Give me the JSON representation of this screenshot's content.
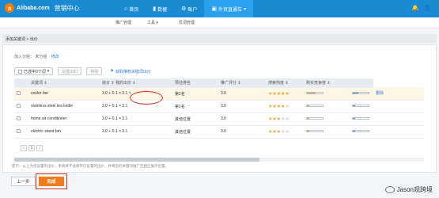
{
  "header": {
    "logo_mark": "a",
    "logo_text": "Alibaba.com",
    "logo_sub": "营销中心",
    "nav": [
      {
        "icon": "⌂",
        "label": "首页"
      },
      {
        "icon": "▮",
        "label": "数据"
      },
      {
        "icon": "⚙",
        "label": "账户"
      },
      {
        "icon": "▣",
        "label": "外贸直通车",
        "suffix": "▾"
      }
    ],
    "right_icons": [
      "🔔",
      "👤"
    ]
  },
  "subnav": {
    "items": [
      "推广管理",
      "工具 ▾",
      "优词管理"
    ]
  },
  "breadcrumb": "添加关键词 > 出价",
  "group": {
    "label": "加入分组：",
    "value": "未分组",
    "edit": "修改"
  },
  "toolbar": {
    "select": "已选中0个词",
    "buttons": [
      "设置出价",
      "移除"
    ],
    "link": "获取推荐关键词出价"
  },
  "table": {
    "headers": [
      "",
      "关键词 ⇕",
      "底价 ⇕ 我的出价 ⇕",
      "预估排名",
      "推广评分 ⇕",
      "搜索热度 ⇕",
      "购买竞争度 ⇕",
      ""
    ],
    "rows": [
      {
        "keyword": "cooler fan",
        "bid": "3.0  +  0.1  =  3.1",
        "rank": "第1名",
        "score": "3.0",
        "stars": 5,
        "heat": 0.55,
        "comp": 0.35,
        "action": "删除"
      },
      {
        "keyword": "stainless steel tea kettle",
        "bid": "3.0  +  0.1  =  3.1",
        "rank": "第1名",
        "score": "3.0",
        "stars": 4,
        "heat": 0.15,
        "comp": 0.15,
        "action": ""
      },
      {
        "keyword": "home air conditioner",
        "bid": "3.0  +  0.1  =  3.1",
        "rank": "其他位置",
        "score": "3.0",
        "stars": 3,
        "heat": 0.15,
        "comp": 0.15,
        "action": ""
      },
      {
        "keyword": "electric stand fan",
        "bid": "3.0  +  0.1  =  3.1",
        "rank": "其他位置",
        "score": "3.0",
        "stars": 3,
        "heat": 0.15,
        "comp": 0.15,
        "action": ""
      }
    ]
  },
  "pager": {
    "prev": "‹",
    "current": "1",
    "next": "›"
  },
  "note": "提示：以上为您设置的出价，系统将不会保存已设置的出价，并将您的关键词推广至相应展示位置。",
  "actions": {
    "prev": "上一步",
    "done": "完成"
  },
  "watermark": "Jason观跨境"
}
